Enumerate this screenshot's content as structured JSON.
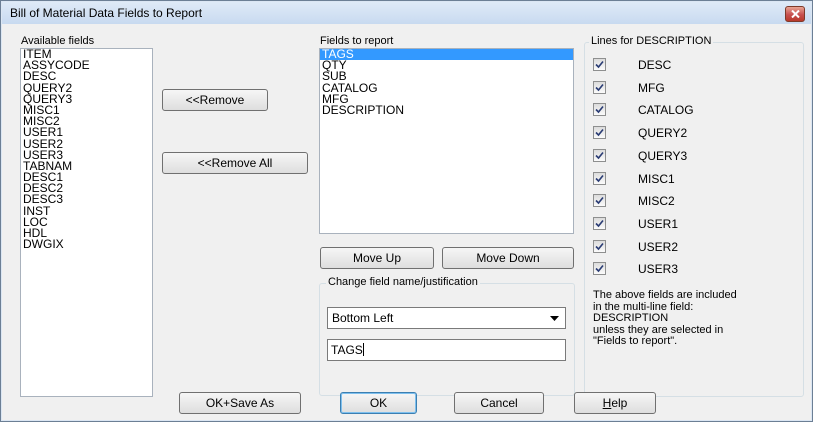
{
  "window": {
    "title": "Bill of Material Data Fields to Report",
    "close_icon": "close-icon"
  },
  "available": {
    "label": "Available fields",
    "items": [
      "ITEM",
      "ASSYCODE",
      "DESC",
      "QUERY2",
      "QUERY3",
      "MISC1",
      "MISC2",
      "USER1",
      "USER2",
      "USER3",
      "TABNAM",
      "DESC1",
      "DESC2",
      "DESC3",
      "INST",
      "LOC",
      "HDL",
      "DWGIX"
    ]
  },
  "buttons": {
    "remove": "<<Remove",
    "remove_all": "<<Remove All",
    "move_up": "Move Up",
    "move_down": "Move Down",
    "ok_save_as": "OK+Save As",
    "ok": "OK",
    "cancel": "Cancel",
    "help_mnemonic": "H",
    "help_rest": "elp"
  },
  "report": {
    "label": "Fields to report",
    "items": [
      "TAGS",
      "QTY",
      "SUB",
      "CATALOG",
      "MFG",
      "DESCRIPTION"
    ],
    "selected_index": 0
  },
  "change": {
    "label": "Change field name/justification",
    "justification_value": "Bottom Left",
    "field_name_value": "TAGS"
  },
  "lines": {
    "label": "Lines for DESCRIPTION",
    "items": [
      {
        "label": "DESC",
        "checked": true
      },
      {
        "label": "MFG",
        "checked": true
      },
      {
        "label": "CATALOG",
        "checked": true
      },
      {
        "label": "QUERY2",
        "checked": true
      },
      {
        "label": "QUERY3",
        "checked": true
      },
      {
        "label": "MISC1",
        "checked": true
      },
      {
        "label": "MISC2",
        "checked": true
      },
      {
        "label": "USER1",
        "checked": true
      },
      {
        "label": "USER2",
        "checked": true
      },
      {
        "label": "USER3",
        "checked": true
      }
    ],
    "note_lines": [
      "The above fields are included",
      "in the multi-line field:",
      "DESCRIPTION",
      "unless they are selected in",
      "\"Fields to report\"."
    ]
  },
  "colors": {
    "selection": "#3399ff",
    "close_button": "#c75050"
  }
}
